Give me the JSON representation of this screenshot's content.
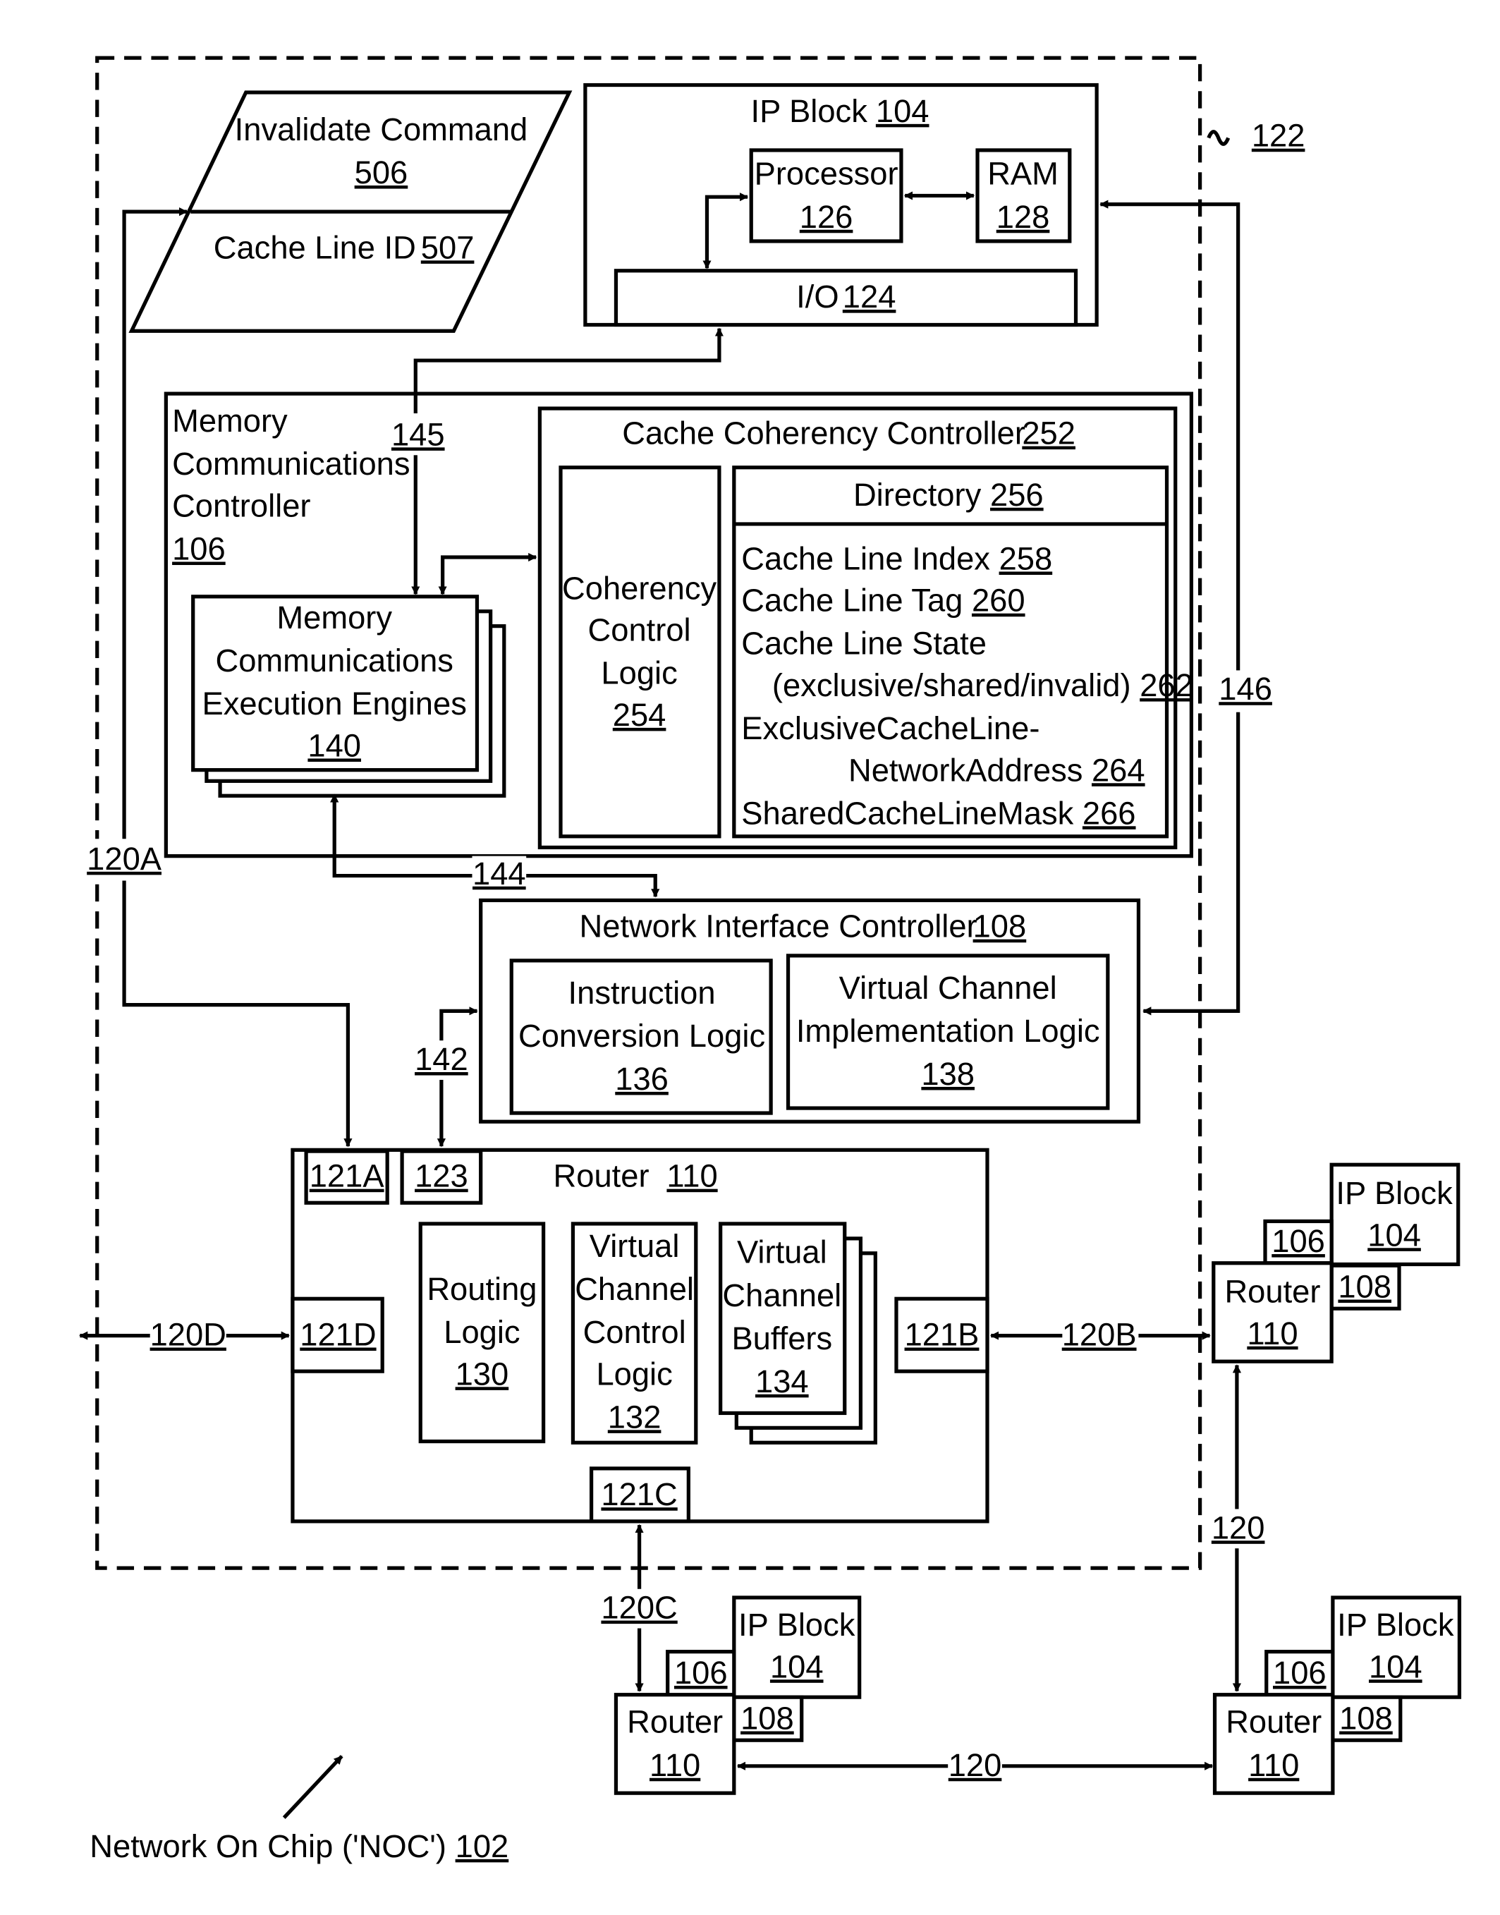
{
  "figure": {
    "noc_label": "Network On Chip ('NOC')",
    "noc_ref": "102",
    "region_ref": "122"
  },
  "invalidate_command": {
    "title": "Invalidate Command",
    "ref": "506",
    "field_label": "Cache Line ID",
    "field_ref": "507"
  },
  "ip_block": {
    "title": "IP Block",
    "ref": "104",
    "processor": {
      "label": "Processor",
      "ref": "126"
    },
    "ram": {
      "label": "RAM",
      "ref": "128"
    },
    "io": {
      "label": "I/O",
      "ref": "124"
    }
  },
  "mcc": {
    "lines": [
      "Memory",
      "Communications",
      "Controller"
    ],
    "ref": "106",
    "engines": {
      "lines": [
        "Memory",
        "Communications",
        "Execution Engines"
      ],
      "ref": "140"
    }
  },
  "ccc": {
    "title": "Cache Coherency Controller",
    "ref": "252",
    "logic": {
      "lines": [
        "Coherency",
        "Control",
        "Logic"
      ],
      "ref": "254"
    },
    "directory": {
      "title": "Directory",
      "ref": "256",
      "entries": [
        {
          "text": "Cache Line Index",
          "ref": "258"
        },
        {
          "text": "Cache Line Tag",
          "ref": "260"
        },
        {
          "text": "Cache Line State",
          "ref": ""
        },
        {
          "text": "(exclusive/shared/invalid)",
          "ref": "262"
        },
        {
          "text": "ExclusiveCacheLine-",
          "ref": ""
        },
        {
          "text": "NetworkAddress",
          "ref": "264"
        },
        {
          "text": "SharedCacheLineMask",
          "ref": "266"
        }
      ]
    }
  },
  "nic": {
    "title": "Network Interface Controller",
    "ref": "108",
    "icl": {
      "lines": [
        "Instruction",
        "Conversion Logic"
      ],
      "ref": "136"
    },
    "vcil": {
      "lines": [
        "Virtual Channel",
        "Implementation Logic"
      ],
      "ref": "138"
    }
  },
  "router": {
    "title": "Router",
    "ref": "110",
    "ports": {
      "a": "121A",
      "b": "121B",
      "c": "121C",
      "d": "121D",
      "nic": "123"
    },
    "routing": {
      "lines": [
        "Routing",
        "Logic"
      ],
      "ref": "130"
    },
    "vccl": {
      "lines": [
        "Virtual",
        "Channel",
        "Control",
        "Logic"
      ],
      "ref": "132"
    },
    "vcb": {
      "lines": [
        "Virtual",
        "Channel",
        "Buffers"
      ],
      "ref": "134"
    }
  },
  "links": {
    "l120a": "120A",
    "l120b": "120B",
    "l120c": "120C",
    "l120d": "120D",
    "l120": "120",
    "l142": "142",
    "l144": "144",
    "l145": "145",
    "l146": "146"
  },
  "remote_nodes": [
    {
      "ip_label": "IP Block",
      "ip_ref": "104",
      "mcc_ref": "106",
      "nic_ref": "108",
      "router_label": "Router",
      "router_ref": "110"
    },
    {
      "ip_label": "IP Block",
      "ip_ref": "104",
      "mcc_ref": "106",
      "nic_ref": "108",
      "router_label": "Router",
      "router_ref": "110"
    },
    {
      "ip_label": "IP Block",
      "ip_ref": "104",
      "mcc_ref": "106",
      "nic_ref": "108",
      "router_label": "Router",
      "router_ref": "110"
    }
  ]
}
